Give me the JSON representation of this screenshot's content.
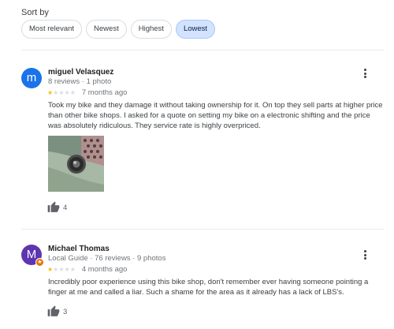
{
  "sort": {
    "label": "Sort by",
    "options": [
      "Most relevant",
      "Newest",
      "Highest",
      "Lowest"
    ],
    "selected": "Lowest"
  },
  "reviews": [
    {
      "avatar_letter": "m",
      "avatar_color": "#1a73e8",
      "name": "miguel Velasquez",
      "meta": "8 reviews · 1 photo",
      "rating": 1,
      "date": "7 months ago",
      "text": "Took my bike and they damage it without taking ownership for it. On top they sell parts at higher price than other bike shops. I asked for a quote on setting my bike on a electronic shifting and the price was absolutely ridiculous. They service rate is highly overpriced.",
      "likes": "4"
    },
    {
      "avatar_letter": "M",
      "avatar_color": "#5e35b1",
      "local_guide_badge": true,
      "name": "Michael Thomas",
      "meta": "Local Guide · 76 reviews · 9 photos",
      "rating": 1,
      "date": "4 months ago",
      "text": "Incredibly poor experience using this bike shop, don't remember ever having someone pointing a finger at me and called a liar. Such a shame for the area as it already has a lack of LBS's.",
      "likes": "3"
    }
  ],
  "colors": {
    "star_filled": "#fbbc04",
    "star_empty": "#dadce0",
    "chip_selected_bg": "#d3e3fd"
  },
  "icons": [
    "more-vert-icon",
    "thumbs-up-icon",
    "local-guide-star-icon"
  ]
}
